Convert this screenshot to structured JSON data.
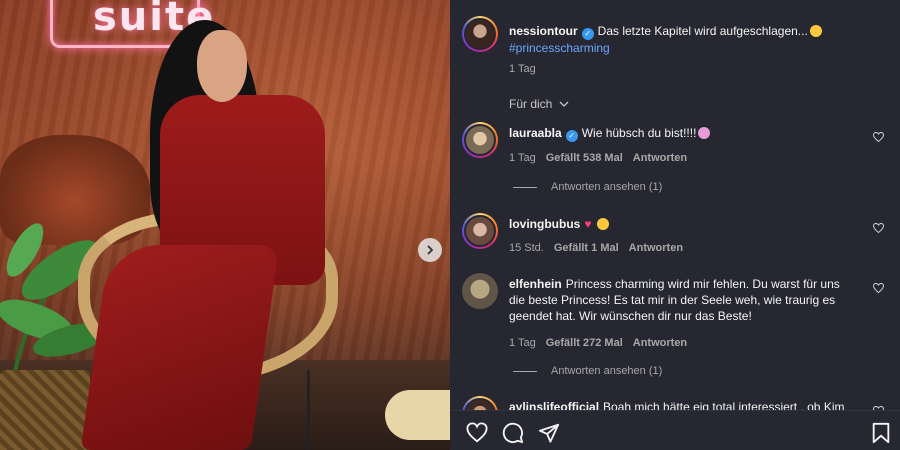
{
  "post": {
    "author": "nessiontour",
    "caption": "Das letzte Kapitel wird aufgeschlagen...",
    "hashtag": "#princesscharming",
    "time": "1 Tag",
    "photo_sign_text": "suite"
  },
  "for_you": "Für dich",
  "comments": [
    {
      "username": "lauraabla",
      "verified": true,
      "text": "Wie hübsch du bist!!!!",
      "time": "1 Tag",
      "likes": "Gefällt 538 Mal",
      "reply": "Antworten",
      "view_replies": "Antworten ansehen (1)"
    },
    {
      "username": "lovingbubus",
      "verified": false,
      "text": "",
      "time": "15 Std.",
      "likes": "Gefällt 1 Mal",
      "reply": "Antworten"
    },
    {
      "username": "elfenhein",
      "verified": false,
      "text": "Princess charming wird mir fehlen. Du warst für uns die beste Princess! Es tat mir in der Seele weh, wie traurig es geendet hat. Wir wünschen dir nur das Beste!",
      "time": "1 Tag",
      "likes": "Gefällt 272 Mal",
      "reply": "Antworten",
      "view_replies": "Antworten ansehen (1)"
    },
    {
      "username": "aylinslifeofficial",
      "verified": false,
      "text": "Boah mich hätte eig total interessiert , ob Kim"
    }
  ],
  "icons": {
    "like": "heart-icon",
    "comment": "comment-icon",
    "share": "share-icon",
    "save": "bookmark-icon",
    "next": "chevron-right-icon"
  },
  "colors": {
    "panel_bg": "#262730",
    "link": "#6aa6ff",
    "verified": "#3897f0"
  }
}
